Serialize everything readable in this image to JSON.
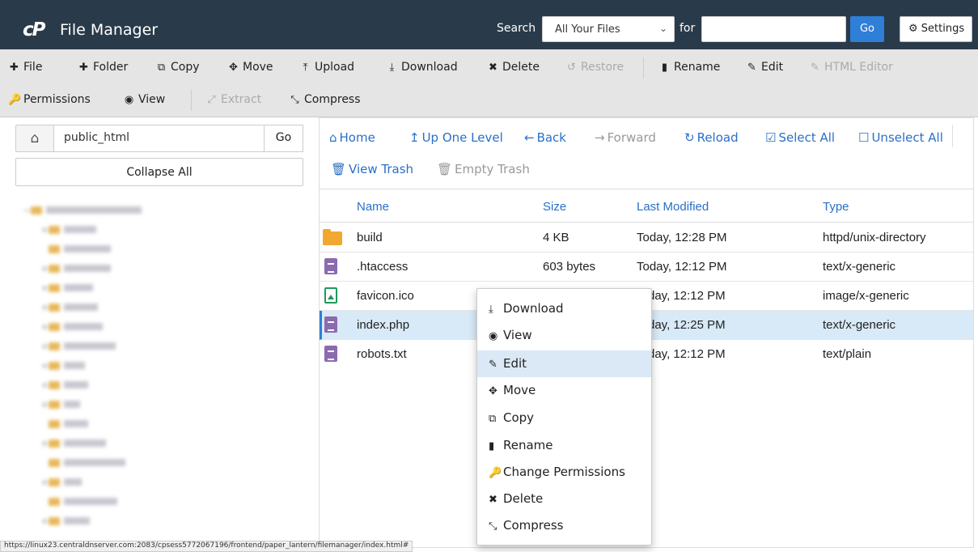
{
  "header": {
    "logo": "cP",
    "title": "File Manager",
    "search_label": "Search",
    "search_scope": "All Your Files",
    "for_label": "for",
    "search_value": "",
    "go_label": "Go",
    "settings_label": "Settings"
  },
  "toolbar": {
    "file": "File",
    "folder": "Folder",
    "copy": "Copy",
    "move": "Move",
    "upload": "Upload",
    "download": "Download",
    "delete": "Delete",
    "restore": "Restore",
    "rename": "Rename",
    "edit": "Edit",
    "html_editor": "HTML Editor",
    "permissions": "Permissions",
    "view": "View",
    "extract": "Extract",
    "compress": "Compress"
  },
  "sidebar": {
    "path": "public_html",
    "go_label": "Go",
    "collapse_label": "Collapse All"
  },
  "nav": {
    "home": "Home",
    "up": "Up One Level",
    "back": "Back",
    "forward": "Forward",
    "reload": "Reload",
    "select_all": "Select All",
    "unselect_all": "Unselect All",
    "view_trash": "View Trash",
    "empty_trash": "Empty Trash"
  },
  "table": {
    "headers": {
      "name": "Name",
      "size": "Size",
      "modified": "Last Modified",
      "type": "Type"
    },
    "rows": [
      {
        "icon": "folder-icon",
        "name": "build",
        "size": "4 KB",
        "modified": "Today, 12:28 PM",
        "type": "httpd/unix-directory"
      },
      {
        "icon": "text-file-icon",
        "name": ".htaccess",
        "size": "603 bytes",
        "modified": "Today, 12:12 PM",
        "type": "text/x-generic"
      },
      {
        "icon": "image-file-icon",
        "name": "favicon.ico",
        "size": "",
        "modified": "day, 12:12 PM",
        "type": "image/x-generic"
      },
      {
        "icon": "text-file-icon",
        "name": "index.php",
        "size": "",
        "modified": "day, 12:25 PM",
        "type": "text/x-generic"
      },
      {
        "icon": "text-file-icon",
        "name": "robots.txt",
        "size": "",
        "modified": "day, 12:12 PM",
        "type": "text/plain"
      }
    ]
  },
  "context_menu": {
    "download": "Download",
    "view": "View",
    "edit": "Edit",
    "move": "Move",
    "copy": "Copy",
    "rename": "Rename",
    "change_permissions": "Change Permissions",
    "delete": "Delete",
    "compress": "Compress"
  },
  "status_url": "https://linux23.centraldnserver.com:2083/cpsess5772067196/frontend/paper_lantern/filemanager/index.html#",
  "colors": {
    "header_bg": "#293a4a",
    "accent": "#2f7ed8",
    "selected_row": "#d8eaf7"
  }
}
